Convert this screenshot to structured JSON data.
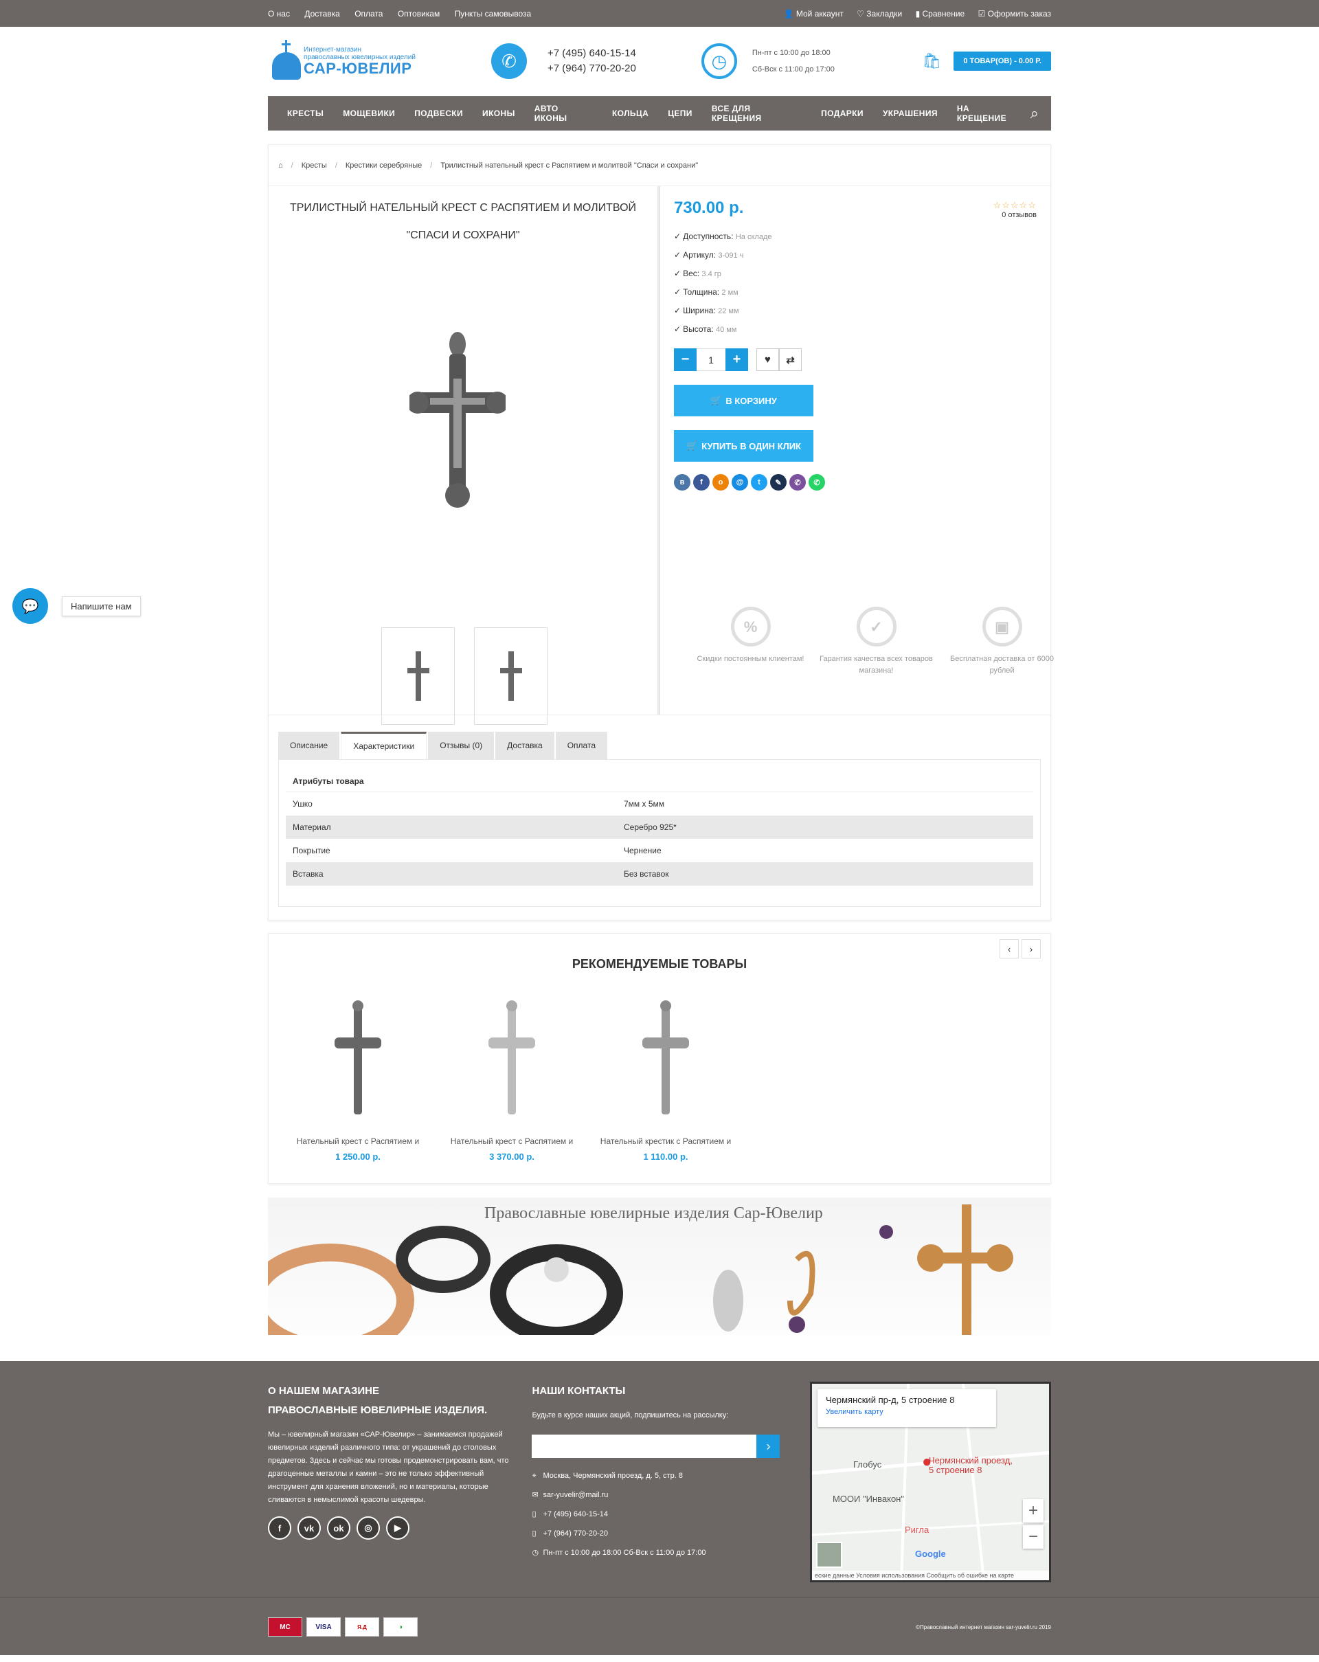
{
  "topbar": {
    "links": [
      "О нас",
      "Доставка",
      "Оплата",
      "Оптовикам",
      "Пункты самовывоза"
    ],
    "account": "Мой аккаунт",
    "bookmarks": "Закладки",
    "compare": "Сравнение",
    "checkout": "Оформить заказ"
  },
  "header": {
    "logo_line1": "Интернет-магазин",
    "logo_line2": "православных ювелирных изделий",
    "logo_name": "САР-ЮВЕЛИР",
    "phone1": "+7 (495) 640-15-14",
    "phone2": "+7 (964) 770-20-20",
    "hours1": "Пн-пт с 10:00 до 18:00",
    "hours2": "Сб-Вск с 11:00 до 17:00",
    "cart_label": "0 ТОВАР(ОВ) - 0.00 Р."
  },
  "menu": [
    "КРЕСТЫ",
    "МОЩЕВИКИ",
    "ПОДВЕСКИ",
    "ИКОНЫ",
    "АВТО ИКОНЫ",
    "КОЛЬЦА",
    "ЦЕПИ",
    "ВСЕ ДЛЯ КРЕЩЕНИЯ",
    "ПОДАРКИ",
    "УКРАШЕНИЯ",
    "НА КРЕЩЕНИЕ"
  ],
  "breadcrumb": [
    "Кресты",
    "Крестики серебряные",
    "Трилистный нательный крест с Распятием и молитвой \"Спаси и сохрани\""
  ],
  "product": {
    "title": "ТРИЛИСТНЫЙ НАТЕЛЬНЫЙ КРЕСТ С РАСПЯТИЕМ И МОЛИТВОЙ \"СПАСИ И СОХРАНИ\"",
    "price": "730.00 р.",
    "reviews": "0 отзывов",
    "rating": 0,
    "specs": [
      {
        "k": "Доступность:",
        "v": "На складе"
      },
      {
        "k": "Артикул:",
        "v": "3-091 ч"
      },
      {
        "k": "Вес:",
        "v": "3.4 гр"
      },
      {
        "k": "Толщина:",
        "v": "2 мм"
      },
      {
        "k": "Ширина:",
        "v": "22 мм"
      },
      {
        "k": "Высота:",
        "v": "40 мм"
      }
    ],
    "qty": "1",
    "cart_btn": "В КОРЗИНУ",
    "oneclick_btn": "КУПИТЬ В ОДИН КЛИК",
    "perks": [
      "Скидки постоянным клиентам!",
      "Гарантия качества всех товаров магазина!",
      "Бесплатная доставка от 6000 рублей"
    ]
  },
  "tabs": [
    "Описание",
    "Характеристики",
    "Отзывы (0)",
    "Доставка",
    "Оплата"
  ],
  "active_tab": "Характеристики",
  "attributes": {
    "heading": "Атрибуты товара",
    "rows": [
      {
        "k": "Ушко",
        "v": "7мм х 5мм"
      },
      {
        "k": "Материал",
        "v": "Серебро 925*"
      },
      {
        "k": "Покрытие",
        "v": "Чернение"
      },
      {
        "k": "Вставка",
        "v": "Без вставок"
      }
    ]
  },
  "recommended": {
    "title": "РЕКОМЕНДУЕМЫЕ ТОВАРЫ",
    "items": [
      {
        "name": "Нательный крест с Распятием и",
        "price": "1 250.00 р."
      },
      {
        "name": "Нательный крест с Распятием и",
        "price": "3 370.00 р."
      },
      {
        "name": "Нательный крестик с Распятием и",
        "price": "1 110.00 р."
      }
    ]
  },
  "banner_title": "Православные ювелирные изделия Сар-Ювелир",
  "footer": {
    "about_h1": "О НАШЕМ МАГАЗИНЕ",
    "about_h2": "ПРАВОСЛАВНЫЕ ЮВЕЛИРНЫЕ ИЗДЕЛИЯ.",
    "about_text": "Мы – ювелирный магазин «САР-Ювелир» – занимаемся продажей ювелирных изделий различного типа: от украшений до столовых предметов. Здесь и сейчас мы готовы продемонстрировать вам, что драгоценные металлы и камни – это не только эффективный инструмент для хранения вложений, но и материалы, которые сливаются в немыслимой красоты шедевры.",
    "contacts_h": "НАШИ КОНТАКТЫ",
    "subscribe": "Будьте в курсе наших акций, подпишитесь на рассылку:",
    "address": "Москва, Чермянский проезд, д. 5, стр. 8",
    "email": "sar-yuvelir@mail.ru",
    "phone1": "+7 (495) 640-15-14",
    "phone2": "+7 (964) 770-20-20",
    "hours": "Пн-пт с 10:00 до 18:00 Сб-Вск с 11:00 до 17:00",
    "map_address": "Чермянский пр-д, 5 строение 8",
    "map_zoom_link": "Увеличить карту",
    "map_marker": "Чермянский проезд, 5 строение 8",
    "map_globus": "Глобус",
    "map_mooi": "МООИ \"Инвакон\"",
    "map_rigla": "Ригла",
    "map_google": "Google",
    "map_bottom": "еские данные    Условия использования    Сообщить об ошибке на карте",
    "copyright": "©Православный интернет магазин sar-yuvelir.ru 2019"
  },
  "chat_label": "Напишите нам",
  "colors": {
    "accent": "#1a9be0",
    "bars": "#6c6764"
  }
}
